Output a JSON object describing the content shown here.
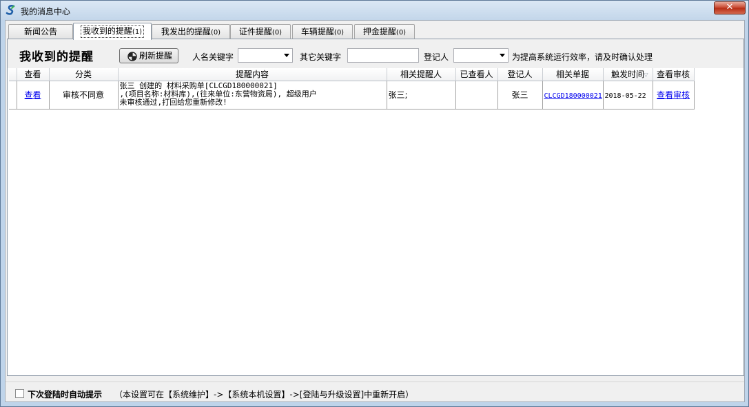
{
  "window": {
    "title": "我的消息中心",
    "close_label": "✕"
  },
  "tabs": [
    {
      "label": "新闻公告",
      "count": ""
    },
    {
      "label": "我收到的提醒",
      "count": "(1)"
    },
    {
      "label": "我发出的提醒",
      "count": "(0)"
    },
    {
      "label": "证件提醒",
      "count": "(0)"
    },
    {
      "label": "车辆提醒",
      "count": "(0)"
    },
    {
      "label": "押金提醒",
      "count": "(0)"
    }
  ],
  "toolbar": {
    "title": "我收到的提醒",
    "refresh_label": "刷新提醒",
    "name_keyword_label": "人名关键字",
    "name_keyword_value": "",
    "other_keyword_label": "其它关键字",
    "other_keyword_value": "",
    "registrant_label": "登记人",
    "registrant_value": "",
    "hint": "为提高系统运行效率，请及时确认处理"
  },
  "grid": {
    "columns": [
      "查看",
      "分类",
      "提醒内容",
      "相关提醒人",
      "已查看人",
      "登记人",
      "相关单据",
      "触发时间",
      "查看审核"
    ],
    "rows": [
      {
        "view": "查看",
        "category": "审核不同意",
        "content": "张三 创建的 材料采购单[CLCGD180000021]\n,(项目名称:材料库),(往来单位:东营物资局), 超级用户\n未审核通过,打回给您重新修改!",
        "related_person": "张三;",
        "viewed_by": "",
        "registrant": "张三",
        "document": "CLCGD180000021",
        "trigger_time": "2018-05-22",
        "review": "查看审核"
      }
    ]
  },
  "footer": {
    "checkbox_label": "下次登陆时自动提示",
    "checked": false,
    "note": "（本设置可在【系统维护】->【系统本机设置】->[登陆与升级设置]中重新开启）"
  },
  "colors": {
    "link": "#0000ee",
    "title_bar": "#c3d6ea",
    "close_button": "#c7432b"
  }
}
